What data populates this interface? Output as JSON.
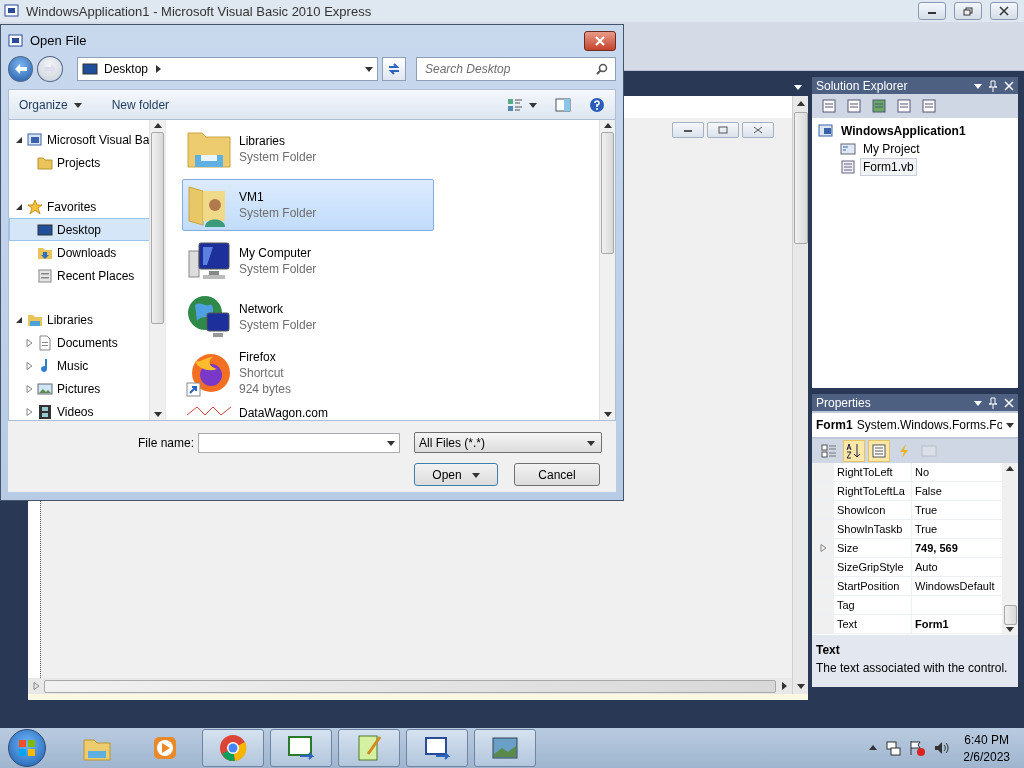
{
  "ide": {
    "title": "WindowsApplication1 - Microsoft Visual Basic 2010 Express"
  },
  "dialog": {
    "title": "Open File",
    "address": "Desktop",
    "search": {
      "placeholder": "Search Desktop"
    },
    "commands": [
      "Organize",
      "New folder"
    ],
    "nav": [
      {
        "label": "Microsoft Visual Ba",
        "kind": "vb",
        "expanded": true,
        "children": [
          {
            "label": "Projects",
            "kind": "folder",
            "selected": false
          }
        ]
      },
      {
        "label": "Favorites",
        "kind": "star",
        "expanded": true,
        "children": [
          {
            "label": "Desktop",
            "kind": "desktop",
            "selected": true
          },
          {
            "label": "Downloads",
            "kind": "downloads",
            "selected": false
          },
          {
            "label": "Recent Places",
            "kind": "recent",
            "selected": false
          }
        ]
      },
      {
        "label": "Libraries",
        "kind": "libraries",
        "expanded": true,
        "children": [
          {
            "label": "Documents",
            "kind": "documents",
            "selected": false,
            "expanded": false
          },
          {
            "label": "Music",
            "kind": "music",
            "selected": false,
            "expanded": false
          },
          {
            "label": "Pictures",
            "kind": "pictures",
            "selected": false,
            "expanded": false
          },
          {
            "label": "Videos",
            "kind": "videos",
            "selected": false,
            "expanded": false
          }
        ]
      }
    ],
    "files": [
      {
        "name": "Libraries",
        "details": [
          "System Folder"
        ],
        "kind": "libraries",
        "selected": false
      },
      {
        "name": "VM1",
        "details": [
          "System Folder"
        ],
        "kind": "user",
        "selected": true
      },
      {
        "name": "My Computer",
        "details": [
          "System Folder"
        ],
        "kind": "computer",
        "selected": false
      },
      {
        "name": "Network",
        "details": [
          "System Folder"
        ],
        "kind": "network",
        "selected": false
      },
      {
        "name": "Firefox",
        "details": [
          "Shortcut",
          "924 bytes"
        ],
        "kind": "firefox",
        "selected": false
      },
      {
        "name": "DataWagon.com",
        "kind": "web",
        "selected": false
      }
    ],
    "file_name_label": "File name:",
    "filter": "All Files (*.*)",
    "buttons": [
      "Open",
      "Cancel"
    ]
  },
  "solution_explorer": {
    "title": "Solution Explorer",
    "tree": [
      {
        "label": "WindowsApplication1",
        "selected": false,
        "children": [
          {
            "label": "My Project",
            "kind": "project",
            "selected": false
          },
          {
            "label": "Form1.vb",
            "kind": "form",
            "selected": true
          }
        ]
      }
    ]
  },
  "properties": {
    "title": "Properties",
    "object": "Form1",
    "type": "System.Windows.Forms.Fo",
    "toolbar": [
      {
        "kind": "categorized",
        "selected": false,
        "disabled": false
      },
      {
        "kind": "alphabetical",
        "selected": true,
        "disabled": false
      },
      {
        "kind": "properties",
        "selected": true,
        "disabled": false
      },
      {
        "kind": "events",
        "selected": false,
        "disabled": false
      },
      {
        "kind": "pages",
        "selected": false,
        "disabled": true
      }
    ],
    "rows": [
      {
        "name": "RightToLeft",
        "value": "No",
        "modified": false
      },
      {
        "name": "RightToLeftLa",
        "value": "False",
        "modified": false
      },
      {
        "name": "ShowIcon",
        "value": "True",
        "modified": false
      },
      {
        "name": "ShowInTaskb",
        "value": "True",
        "modified": false
      },
      {
        "name": "Size",
        "value": "749, 569",
        "modified": true,
        "expanded": false
      },
      {
        "name": "SizeGripStyle",
        "value": "Auto",
        "modified": false
      },
      {
        "name": "StartPosition",
        "value": "WindowsDefault",
        "modified": false
      },
      {
        "name": "Tag"
      },
      {
        "name": "Text",
        "value": "Form1",
        "modified": true
      }
    ],
    "description": {
      "title": "Text",
      "text": "The text associated with the control."
    }
  },
  "taskbar": {
    "items": [
      {
        "kind": "explorer",
        "running": false
      },
      {
        "kind": "media",
        "running": false
      },
      {
        "kind": "chrome",
        "running": true
      },
      {
        "kind": "csharp",
        "running": true
      },
      {
        "kind": "notepad",
        "running": true
      },
      {
        "kind": "vb",
        "running": true
      },
      {
        "kind": "photos",
        "running": true
      }
    ],
    "time": "6:40 PM",
    "date": "2/6/2023"
  }
}
